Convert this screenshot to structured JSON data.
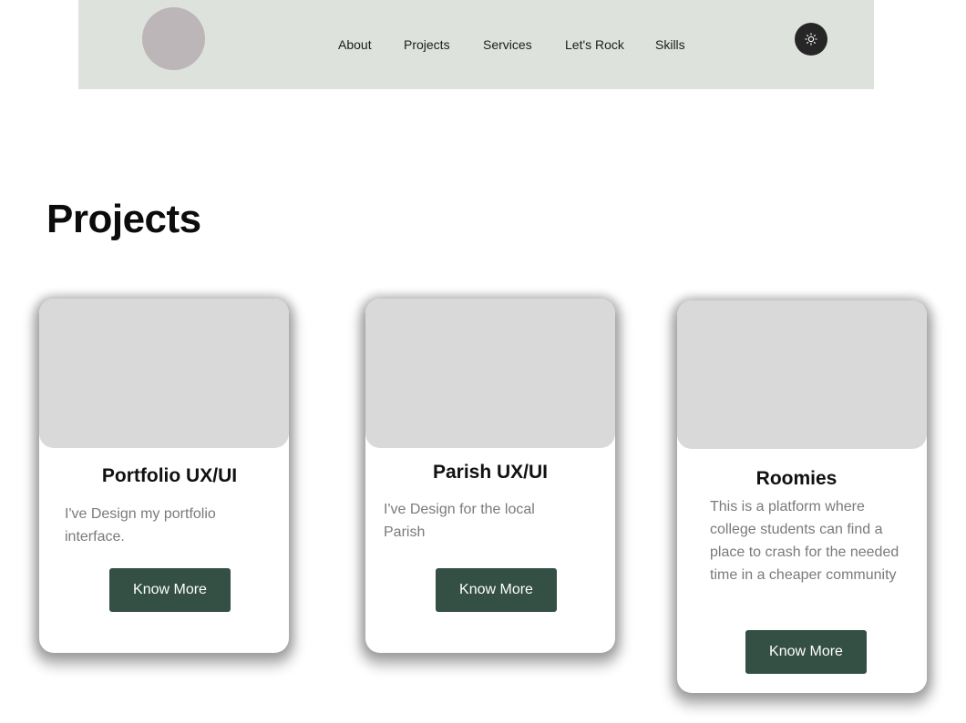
{
  "nav": {
    "links": [
      "About",
      "Projects",
      "Services",
      "Let's Rock",
      "Skills"
    ],
    "theme_icon": "sun-icon"
  },
  "colors": {
    "nav_background": "#dde3dc",
    "avatar": "#bdb6b8",
    "button": "#344f43",
    "card_image": "#d9d9d9",
    "toggle": "#262626"
  },
  "projects": {
    "title": "Projects",
    "cards": [
      {
        "title": "Portfolio UX/UI",
        "description": "I've Design my portfolio interface.",
        "button_label": "Know More"
      },
      {
        "title": "Parish UX/UI",
        "description": "I've Design for the local Parish",
        "button_label": "Know More"
      },
      {
        "title": "Roomies",
        "description": "This is a platform where college students can find a place to crash for the needed time in a cheaper community",
        "button_label": "Know More"
      }
    ]
  }
}
